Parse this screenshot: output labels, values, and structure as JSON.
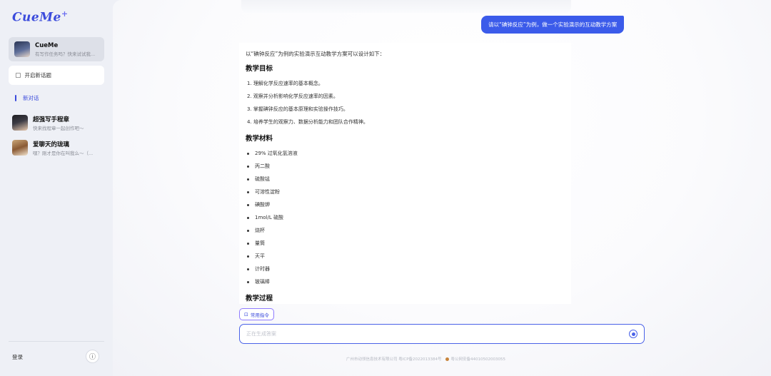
{
  "app": {
    "logo": "CueMe",
    "logo_sup": "+"
  },
  "sidebar": {
    "bot": {
      "name": "CueMe",
      "desc": "有写作任务吗？快来试试我..."
    },
    "new_topic": "开启新话题",
    "current_conversation": "新对话",
    "recent": [
      {
        "name": "超强写手程章",
        "desc": "快来找程章一起创作吧～"
      },
      {
        "name": "爱聊天的珑璃",
        "desc": "嘿？刚才是你在叫我么～（..."
      }
    ],
    "login": "登录",
    "info_icon": "info-icon"
  },
  "chat": {
    "user_message": "请以“碘钟反应”为例，做一个实验演示的互动教学方案",
    "answer": {
      "intro": "以“碘钟反应”为例的实验演示互动教学方案可以设计如下：",
      "goal_heading": "教学目标",
      "goals": [
        "1. 理解化学反应速率的基本概念。",
        "2. 观察并分析影响化学反应速率的因素。",
        "3. 掌握碘钟反应的基本原理和实验操作技巧。",
        "4. 培养学生的观察力、数据分析能力和团队合作精神。"
      ],
      "materials_heading": "教学材料",
      "materials": [
        "29% 过氧化氢溶液",
        "丙二酸",
        "硫酸锰",
        "可溶性淀粉",
        "碘酸钾",
        "1mol/L 硫酸",
        "烧杯",
        "量筒",
        "天平",
        "计时器",
        "玻璃棒"
      ],
      "process_heading": "教学过程"
    }
  },
  "composer": {
    "command_button": "常用指令",
    "placeholder": "正在生成答案"
  },
  "footer": {
    "icp": "广州市动领信息技术有限公司 粤ICP备2022013384号",
    "police": "粤公网安备44010502003055"
  }
}
